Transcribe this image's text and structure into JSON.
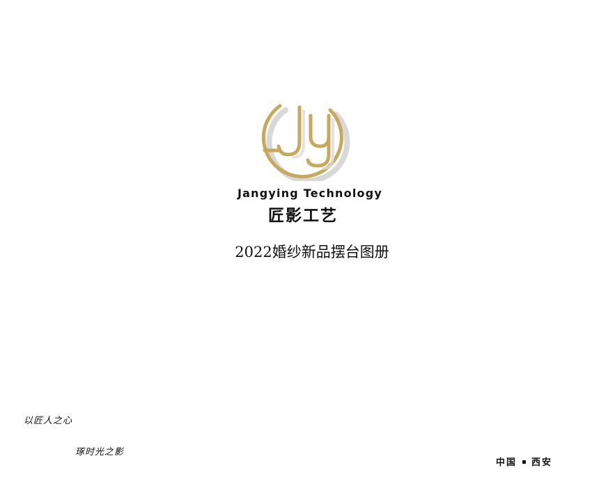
{
  "brand": {
    "logo_icon": "jy-monogram-logo-icon",
    "logo_monogram": "JY",
    "name_en": "Jangying Technology",
    "name_cn": "匠影工艺",
    "logo_color": "#C8A85A"
  },
  "document": {
    "title": "2022婚纱新品摆台图册"
  },
  "slogans": {
    "line1": "以匠人之心",
    "line2": "琢时光之影"
  },
  "location": {
    "country": "中国",
    "city": "西安"
  }
}
